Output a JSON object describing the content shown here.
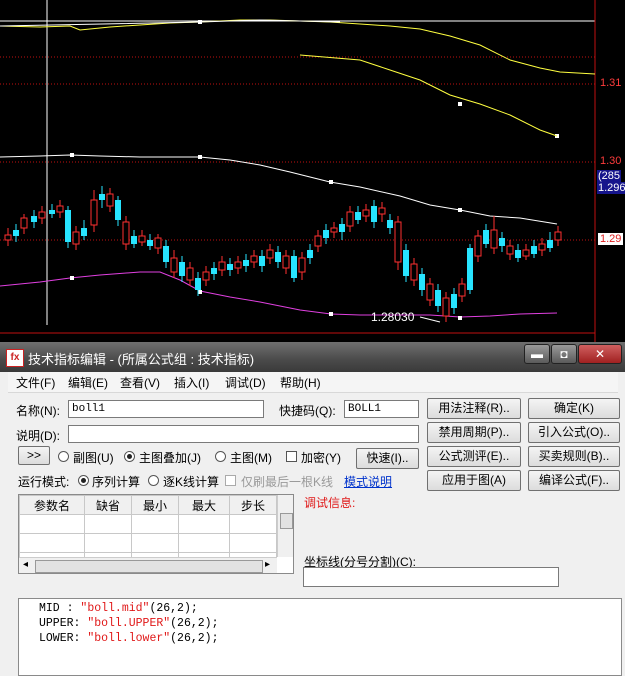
{
  "chart": {
    "price_labels": {
      "p1": "1.31",
      "p2": "1.30",
      "p3": "(285",
      "p4": "1.296",
      "p5": "1.29",
      "low_annot": "1.28030"
    },
    "colors": {
      "candle_up": "#ff3030",
      "candle_down": "#27e4ff",
      "mid_line": "#ffffff",
      "upper_line": "#ffff40",
      "lower_line": "#e040e0",
      "grid": "#c01010"
    }
  },
  "dialog": {
    "title": "技术指标编辑 - (所属公式组 : 技术指标)",
    "window_buttons": {
      "minimize": "▬",
      "maximize": "◘",
      "close": "✕"
    },
    "menu": [
      "文件(F)",
      "编辑(E)",
      "查看(V)",
      "插入(I)",
      "调试(D)",
      "帮助(H)"
    ],
    "form": {
      "name_label": "名称(N):",
      "name_value": "boll1",
      "shortcut_label": "快捷码(Q):",
      "shortcut_value": "BOLL1",
      "desc_label": "说明(D):",
      "desc_value": "",
      "expand_btn": ">>",
      "radio_sub": "副图(U)",
      "radio_main_overlay": "主图叠加(J)",
      "radio_main": "主图(M)",
      "chk_encrypt": "加密(Y)",
      "quick_btn": "快速(I)..",
      "mode_label": "运行模式:",
      "mode_seq": "序列计算",
      "mode_kline": "逐K线计算",
      "mode_last": "仅刷最后一根K线",
      "mode_link": "模式说明",
      "debug_label": "调试信息:",
      "axis_label": "坐标线(分号分割)(C):",
      "axis_value": ""
    },
    "buttons": {
      "usage_note": "用法注释(R)..",
      "confirm": "确定(K)",
      "ban_period": "禁用周期(P)..",
      "import": "引入公式(O)..",
      "formula_test": "公式测评(E)..",
      "trade_rule": "买卖规则(B)..",
      "apply_chart": "应用于图(A)",
      "compile": "编译公式(F).."
    },
    "param_table": {
      "headers": [
        "参数名",
        "缺省",
        "最小",
        "最大",
        "步长"
      ],
      "rows": [
        [
          "",
          "",
          "",
          "",
          ""
        ],
        [
          "",
          "",
          "",
          "",
          ""
        ],
        [
          "",
          "",
          "",
          "",
          ""
        ]
      ]
    },
    "code": [
      {
        "name": "MID :",
        "str": "\"boll.mid\"",
        "args": "(26,2);"
      },
      {
        "name": "UPPER:",
        "str": "\"boll.UPPER\"",
        "args": "(26,2);"
      },
      {
        "name": "LOWER:",
        "str": "\"boll.lower\"",
        "args": "(26,2);"
      }
    ]
  }
}
